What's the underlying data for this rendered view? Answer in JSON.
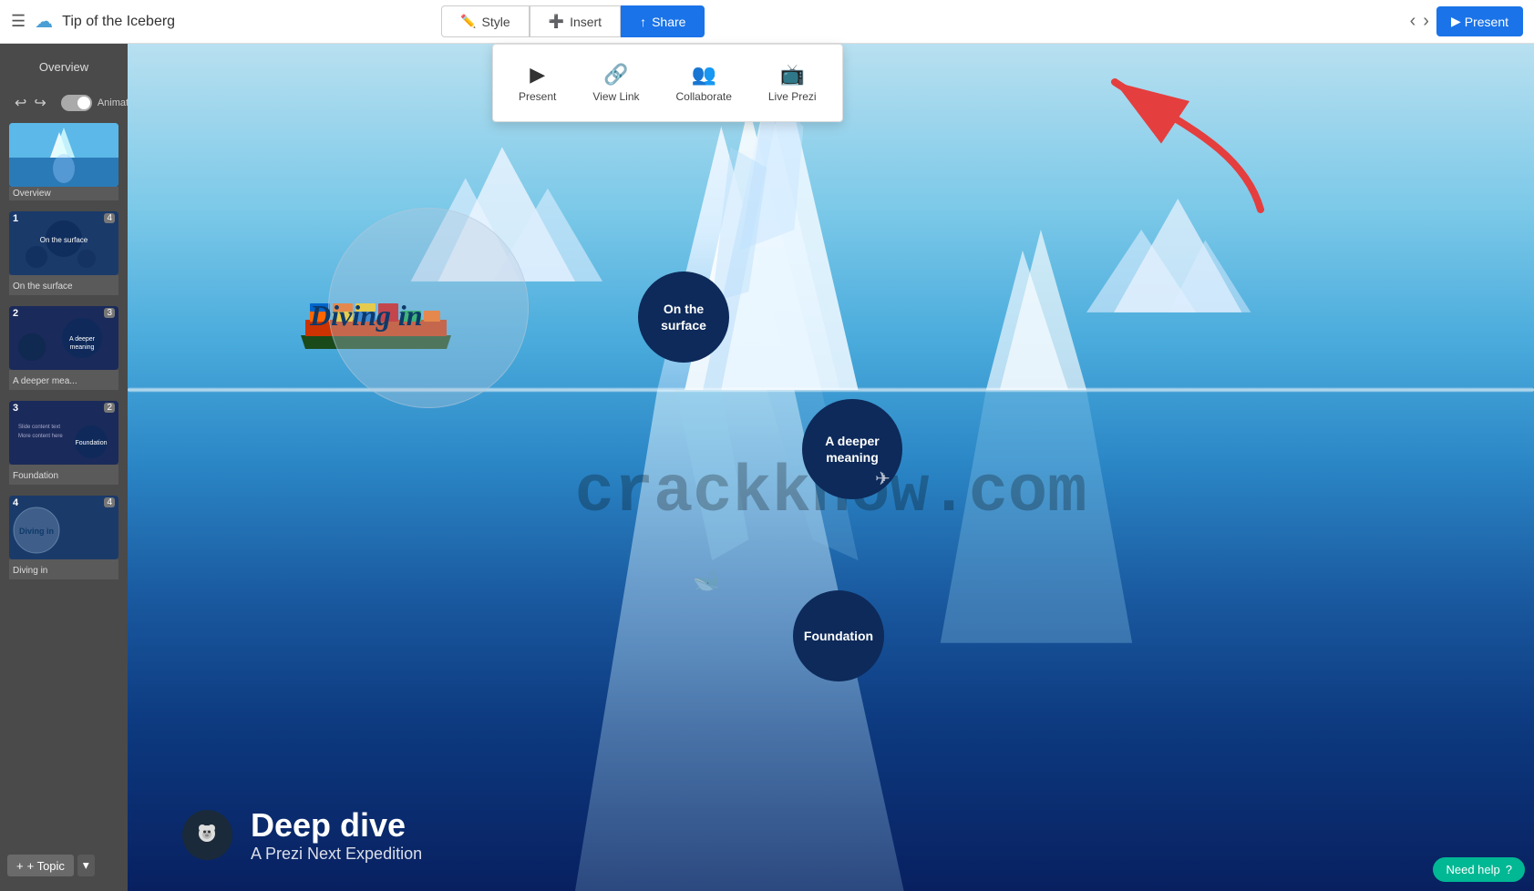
{
  "topbar": {
    "title": "Tip of the Iceberg",
    "tabs": [
      {
        "id": "style",
        "label": "Style",
        "icon": "✏️"
      },
      {
        "id": "insert",
        "label": "Insert",
        "icon": "➕"
      },
      {
        "id": "share",
        "label": "Share",
        "icon": "↑"
      }
    ],
    "present_label": "Present",
    "share_dropdown": {
      "options": [
        {
          "id": "present",
          "label": "Present",
          "icon": "▶"
        },
        {
          "id": "view-link",
          "label": "View Link",
          "icon": "🔗"
        },
        {
          "id": "collaborate",
          "label": "Collaborate",
          "icon": "👥"
        },
        {
          "id": "live-prezi",
          "label": "Live Prezi",
          "icon": "📺"
        }
      ]
    }
  },
  "sidebar": {
    "overview_label": "Overview",
    "animations_label": "Animations",
    "slides": [
      {
        "number": "",
        "label": "Overview",
        "badge": ""
      },
      {
        "number": "1",
        "label": "On the surface",
        "badge": "4"
      },
      {
        "number": "2",
        "label": "A deeper mea...",
        "badge": "3"
      },
      {
        "number": "3",
        "label": "Foundation",
        "badge": "2"
      },
      {
        "number": "4",
        "label": "Diving in",
        "badge": "4"
      }
    ]
  },
  "canvas": {
    "diving_in_label": "Diving in",
    "on_surface_label": "On the\nsurface",
    "deeper_meaning_label": "A deeper\nmeaning",
    "foundation_label": "Foundation",
    "watermark": "crackknow.com",
    "slide_title": "Deep dive",
    "slide_subtitle": "A Prezi Next Expedition"
  },
  "bottom": {
    "topic_label": "+ Topic",
    "need_help_label": "Need help"
  }
}
